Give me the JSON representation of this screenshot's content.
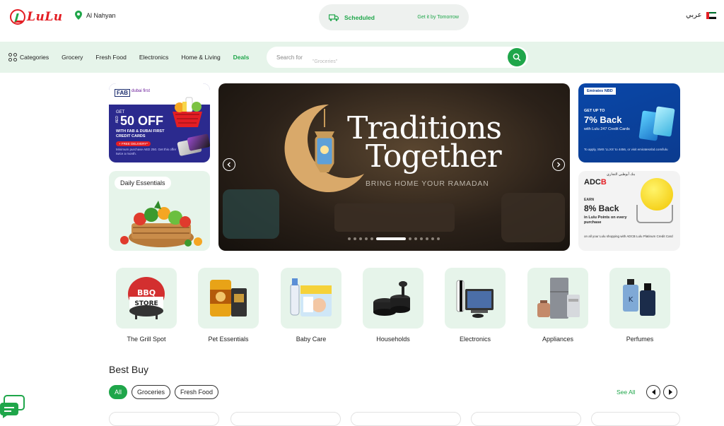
{
  "header": {
    "logo": "LuLu",
    "location": "Al Nahyan",
    "delivery_scheduled": "Scheduled",
    "delivery_tomorrow": "Get it by Tomorrow",
    "language": "عربي"
  },
  "nav": {
    "items": [
      "Categories",
      "Grocery",
      "Fresh Food",
      "Electronics",
      "Home & Living",
      "Deals"
    ],
    "search_placeholder": "Search for",
    "search_hint": "\"Groceries\""
  },
  "promos": {
    "fab": {
      "brand1": "FAB",
      "brand2": "dubai first",
      "get": "GET",
      "aed": "AED",
      "amount": "50 OFF",
      "with": "WITH FAB & DUBAI FIRST CREDIT CARDS",
      "free": "+ FREE DELIVERY*",
      "min": "Minimum purchase AED 250. Get this offer twice a month."
    },
    "daily": "Daily Essentials",
    "enbd": {
      "brand": "Emirates NBD",
      "upto": "GET UP TO",
      "pct": "7% Back",
      "with": "with Lulu 247 Credit Cards",
      "small": "To apply, SMS 'LLXS' to 4456, or visit emiratesnbd.com/lulu"
    },
    "adcb": {
      "brand_a": "ADC",
      "brand_b": "B",
      "arabic": "بنك أبوظبي التجاري",
      "earn": "EARN",
      "back": "8% Back",
      "lulu": "in Lulu Points on every purchase",
      "plat": "on all your Lulu shopping with ADCB Lulu Platinum Credit Card"
    }
  },
  "hero": {
    "title1": "Traditions",
    "title2": "Together",
    "subtitle": "BRING HOME YOUR RAMADAN",
    "slides": 12,
    "active_slide": 5
  },
  "categories": [
    {
      "name": "The Grill Spot",
      "icon": "grill-icon"
    },
    {
      "name": "Pet Essentials",
      "icon": "pet-food-icon"
    },
    {
      "name": "Baby Care",
      "icon": "diapers-icon"
    },
    {
      "name": "Households",
      "icon": "cookware-icon"
    },
    {
      "name": "Electronics",
      "icon": "console-icon"
    },
    {
      "name": "Appliances",
      "icon": "fridge-icon"
    },
    {
      "name": "Perfumes",
      "icon": "perfume-icon"
    }
  ],
  "best_buy": {
    "title": "Best Buy",
    "filters": [
      "All",
      "Groceries",
      "Fresh Food"
    ],
    "see_all": "See All"
  },
  "colors": {
    "brand_green": "#1fa64a",
    "brand_red": "#e31e24",
    "tile_bg": "#e6f4ea"
  }
}
